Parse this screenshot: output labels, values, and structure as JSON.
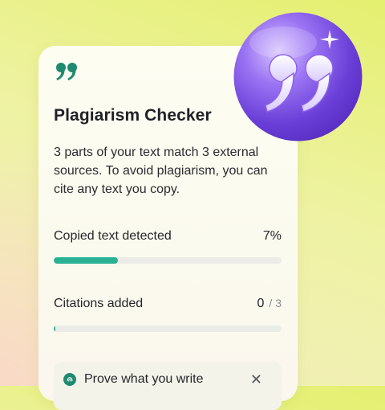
{
  "card": {
    "title": "Plagiarism Checker",
    "description": "3 parts of your text match 3 external sources. To avoid plagiarism, you can cite any text you copy.",
    "metrics": {
      "copied": {
        "label": "Copied text detected",
        "value": "7%",
        "progress_percent": 28
      },
      "citations": {
        "label": "Citations added",
        "value": "0",
        "total": "/ 3",
        "progress_percent": 0
      }
    },
    "banner": {
      "text": "Prove what you write"
    }
  },
  "icons": {
    "card_quote": "quotation-mark-icon",
    "badge": "quotation-mark-orb-icon",
    "banner_icon": "fingerprint-icon",
    "close": "close-icon"
  },
  "colors": {
    "accent": "#2ab092",
    "quote_green": "#1e8a70",
    "orb_purple": "#7b4fe6"
  }
}
